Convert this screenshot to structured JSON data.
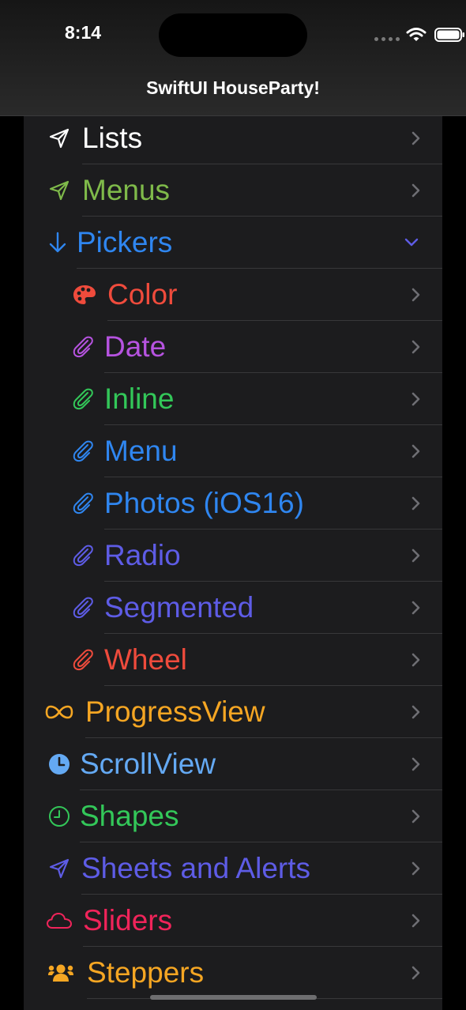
{
  "status_bar": {
    "time": "8:14"
  },
  "nav": {
    "title": "SwiftUI HouseParty!"
  },
  "colors": {
    "white": "#ffffff",
    "green": "#7fba4a",
    "blue": "#2f86f0",
    "red": "#ef4b3c",
    "purple": "#b653e0",
    "bright_green": "#33c759",
    "indigo": "#5e5ce6",
    "orange": "#f5a623",
    "light_blue": "#64a9f3",
    "pink": "#f0245a",
    "chevron": "#6e6e73"
  },
  "items": [
    {
      "label": "Lists",
      "icon": "paperplane-icon",
      "color": "#ffffff"
    },
    {
      "label": "Menus",
      "icon": "paperplane-icon",
      "color": "#7fba4a"
    },
    {
      "label": "Pickers",
      "icon": "arrow-down-icon",
      "color": "#2f86f0",
      "expanded": true
    },
    {
      "label": "Color",
      "icon": "palette-icon",
      "color": "#ef4b3c"
    },
    {
      "label": "Date",
      "icon": "paperclip-icon",
      "color": "#b653e0"
    },
    {
      "label": "Inline",
      "icon": "paperclip-icon",
      "color": "#33c759"
    },
    {
      "label": "Menu",
      "icon": "paperclip-icon",
      "color": "#2f86f0"
    },
    {
      "label": "Photos (iOS16)",
      "icon": "paperclip-icon",
      "color": "#2f86f0"
    },
    {
      "label": "Radio",
      "icon": "paperclip-icon",
      "color": "#5e5ce6"
    },
    {
      "label": "Segmented",
      "icon": "paperclip-icon",
      "color": "#5e5ce6"
    },
    {
      "label": "Wheel",
      "icon": "paperclip-icon",
      "color": "#ef4b3c"
    },
    {
      "label": "ProgressView",
      "icon": "infinity-icon",
      "color": "#f5a623"
    },
    {
      "label": "ScrollView",
      "icon": "clock-fill-icon",
      "color": "#64a9f3"
    },
    {
      "label": "Shapes",
      "icon": "clock-icon",
      "color": "#33c759"
    },
    {
      "label": "Sheets and Alerts",
      "icon": "paperplane-icon",
      "color": "#5e5ce6"
    },
    {
      "label": "Sliders",
      "icon": "cloud-icon",
      "color": "#f0245a"
    },
    {
      "label": "Steppers",
      "icon": "person-group-icon",
      "color": "#f5a623"
    }
  ]
}
